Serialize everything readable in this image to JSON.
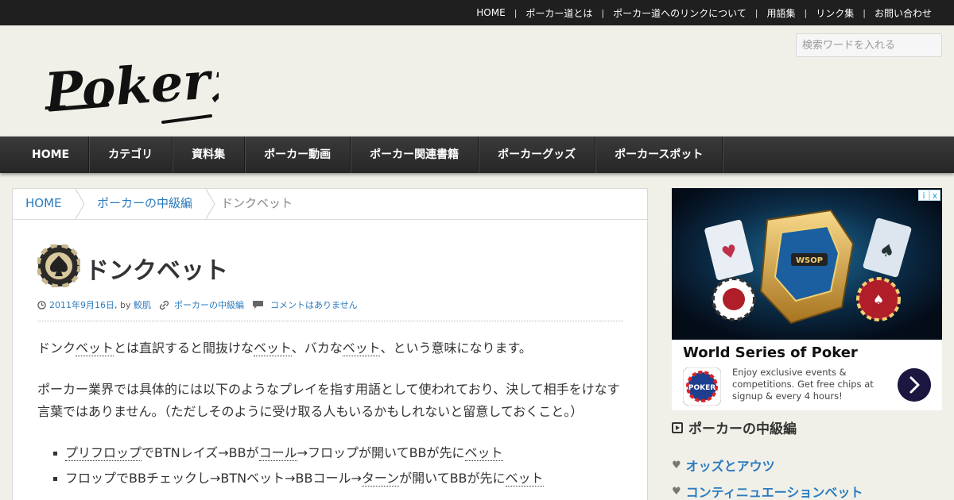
{
  "topnav": [
    "HOME",
    "ポーカー道とは",
    "ポーカー道へのリンクについて",
    "用語集",
    "リンク集",
    "お問い合わせ"
  ],
  "header": {
    "logo_text": "Poker道",
    "search_placeholder": "検索ワードを入れる"
  },
  "mainnav": [
    "HOME",
    "カテゴリ",
    "資料集",
    "ポーカー動画",
    "ポーカー関連書籍",
    "ポーカーグッズ",
    "ポーカースポット"
  ],
  "breadcrumb": {
    "home": "HOME",
    "category": "ポーカーの中級編",
    "current": "ドンクベット"
  },
  "article": {
    "title": "ドンクベット",
    "meta": {
      "date": "2011年9月16日",
      "by": ", by ",
      "author": "鮫肌",
      "category": "ポーカーの中級編",
      "comments": "コメントはありません"
    },
    "p1": [
      "ドンク",
      "ベット",
      "とは直訳すると間抜けな",
      "ベット",
      "、バカな",
      "ベット",
      "、という意味になります。"
    ],
    "p2": "ポーカー業界では具体的には以下のようなプレイを指す用語として使われており、決して相手をけなす言葉ではありません。（ただしそのように受け取る人もいるかもしれないと留意しておくこと。）",
    "list": [
      [
        "プリフロップ",
        "でBTNレイズ→BBが",
        "コール",
        "→フロップが開いてBBが先に",
        "ベット"
      ],
      [
        "フロップでBBチェックし→BTNベット→BBコール→",
        "ターン",
        "が開いてBBが先に",
        "ベット"
      ]
    ]
  },
  "ad": {
    "title": "World Series of Poker",
    "text": "Enjoy exclusive events & competitions. Get free chips at signup & every 4 hours!",
    "badge": [
      "i",
      "x"
    ],
    "image_labels": [
      "WSOP",
      "POKER"
    ]
  },
  "sidebar": {
    "heading": "ポーカーの中級編",
    "items": [
      "オッズとアウツ",
      "コンティニュエーションベット"
    ]
  },
  "colors": {
    "link": "#2a7bbf",
    "nav_bg": "#2f2f2f",
    "topbar_bg": "#1f1f1f",
    "page_bg": "#f1f0e8"
  }
}
